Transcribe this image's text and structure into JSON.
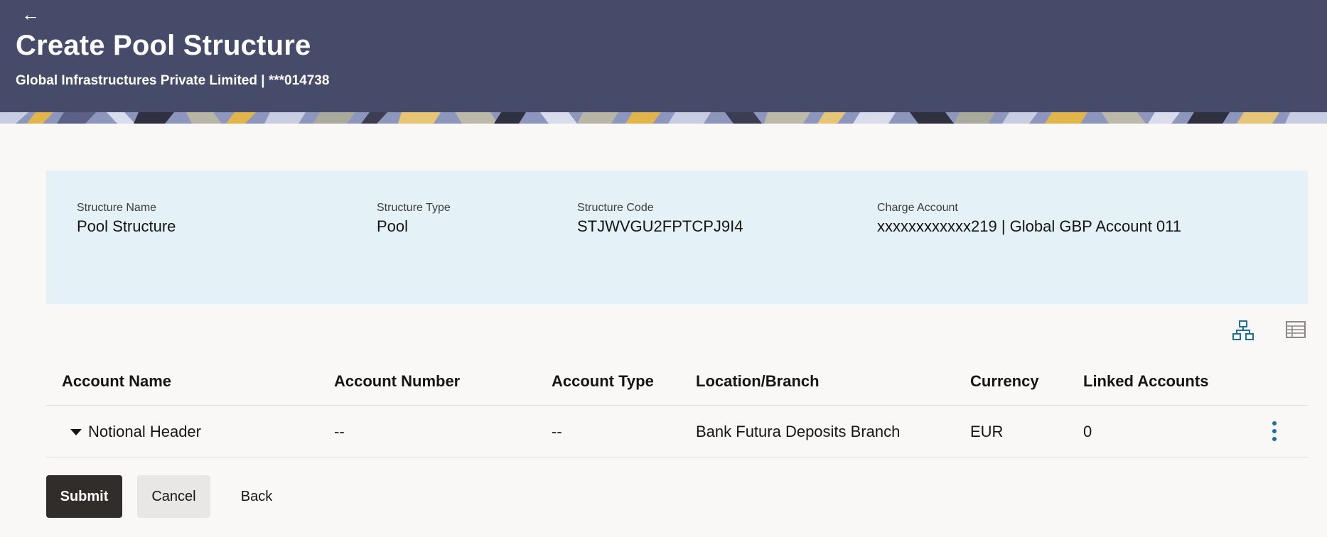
{
  "header": {
    "back_label": "←",
    "title": "Create Pool Structure",
    "subtitle": "Global Infrastructures Private Limited | ***014738"
  },
  "summary": {
    "fields": [
      {
        "label": "Structure Name",
        "value": "Pool Structure"
      },
      {
        "label": "Structure Type",
        "value": "Pool"
      },
      {
        "label": "Structure Code",
        "value": "STJWVGU2FPTCPJ9I4"
      },
      {
        "label": "Charge Account",
        "value": "xxxxxxxxxxxx219 | Global GBP Account 011"
      }
    ]
  },
  "view_toggles": {
    "tree_icon": "hierarchy-icon",
    "table_icon": "table-grid-icon"
  },
  "table": {
    "columns": [
      "Account Name",
      "Account Number",
      "Account Type",
      "Location/Branch",
      "Currency",
      "Linked Accounts"
    ],
    "rows": [
      {
        "account_name": "Notional Header",
        "account_number": "--",
        "account_type": "--",
        "location_branch": "Bank Futura Deposits Branch",
        "currency": "EUR",
        "linked_accounts": "0"
      }
    ]
  },
  "actions": {
    "submit_label": "Submit",
    "cancel_label": "Cancel",
    "back_label": "Back"
  },
  "colors": {
    "header_bg": "#474b6a",
    "summary_bg": "#e4f1f7",
    "primary_button": "#312d2a",
    "icon_accent": "#1a6fa3"
  }
}
